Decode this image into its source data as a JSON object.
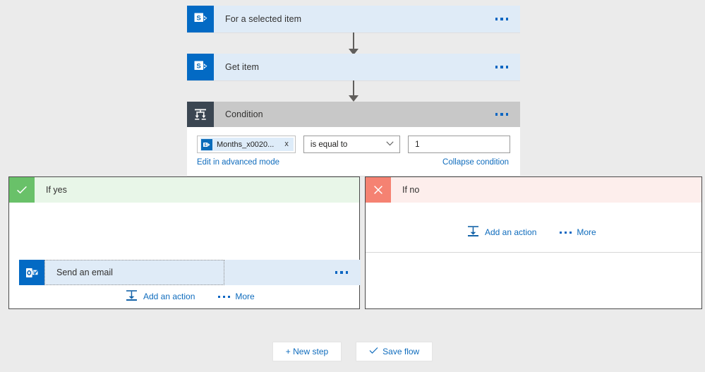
{
  "canvas": {
    "background": "#ebebeb"
  },
  "colors": {
    "card_blue": "#dfebf7",
    "icon_blue": "#036ac4",
    "condition_header": "#c8c8c8",
    "condition_icon": "#3b4652",
    "yes_badge": "#69c169",
    "yes_header": "#e8f6e8",
    "no_badge": "#f58272",
    "no_header": "#fdeeec",
    "link_blue": "#0f6cbd",
    "connector": "#605e5c"
  },
  "nodes": [
    {
      "id": "for-a-selected-item",
      "title": "For a selected item",
      "icon": "sharepoint-icon",
      "menu": "ellipsis-menu"
    },
    {
      "id": "get-item",
      "title": "Get item",
      "icon": "sharepoint-icon",
      "menu": "ellipsis-menu"
    }
  ],
  "condition": {
    "title": "Condition",
    "icon": "condition-branch-icon",
    "menu": "ellipsis-menu",
    "token": {
      "label": "Months_x0020...",
      "icon": "sharepoint-token-icon",
      "remove": "x"
    },
    "operator": {
      "value": "is equal to",
      "chevron": "chevron-down-icon"
    },
    "value": "1",
    "links": {
      "advanced": "Edit in advanced mode",
      "collapse": "Collapse condition"
    }
  },
  "branches": {
    "yes": {
      "label": "If yes",
      "badge_icon": "checkmark-icon",
      "action": {
        "title": "Send an email",
        "icon": "outlook-icon",
        "menu": "ellipsis-menu"
      },
      "add_action": "Add an action",
      "more": "More",
      "add_icon": "add-step-icon"
    },
    "no": {
      "label": "If no",
      "badge_icon": "close-icon",
      "add_action": "Add an action",
      "more": "More",
      "add_icon": "add-step-icon"
    }
  },
  "footer": {
    "new_step": "+ New step",
    "save_flow": "Save flow",
    "save_icon": "checkmark-icon"
  }
}
